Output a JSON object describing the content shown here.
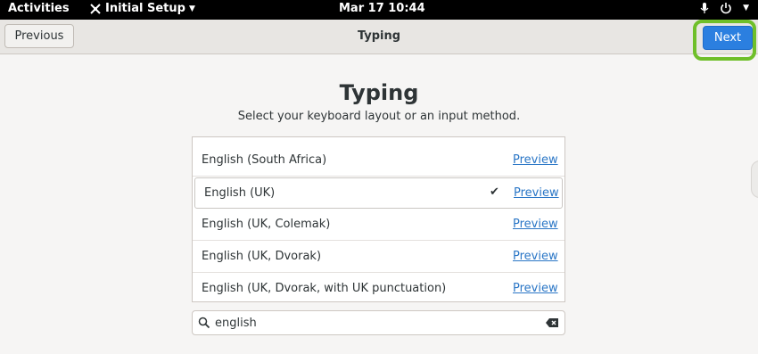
{
  "topbar": {
    "activities": "Activities",
    "app_name": "Initial Setup",
    "clock": "Mar 17  10:44"
  },
  "header": {
    "previous_label": "Previous",
    "title": "Typing",
    "next_label": "Next"
  },
  "main": {
    "title": "Typing",
    "subtitle": "Select your keyboard layout or an input method."
  },
  "layouts": [
    {
      "name": "English (South Africa)",
      "preview": "Preview",
      "selected": false
    },
    {
      "name": "English (UK)",
      "preview": "Preview",
      "selected": true
    },
    {
      "name": "English (UK, Colemak)",
      "preview": "Preview",
      "selected": false
    },
    {
      "name": "English (UK, Dvorak)",
      "preview": "Preview",
      "selected": false
    },
    {
      "name": "English (UK, Dvorak, with UK punctuation)",
      "preview": "Preview",
      "selected": false
    }
  ],
  "search": {
    "value": "english"
  },
  "colors": {
    "accent": "#2b7fe0",
    "highlight_ring": "#6fbf2a",
    "link": "#2a76c6"
  }
}
